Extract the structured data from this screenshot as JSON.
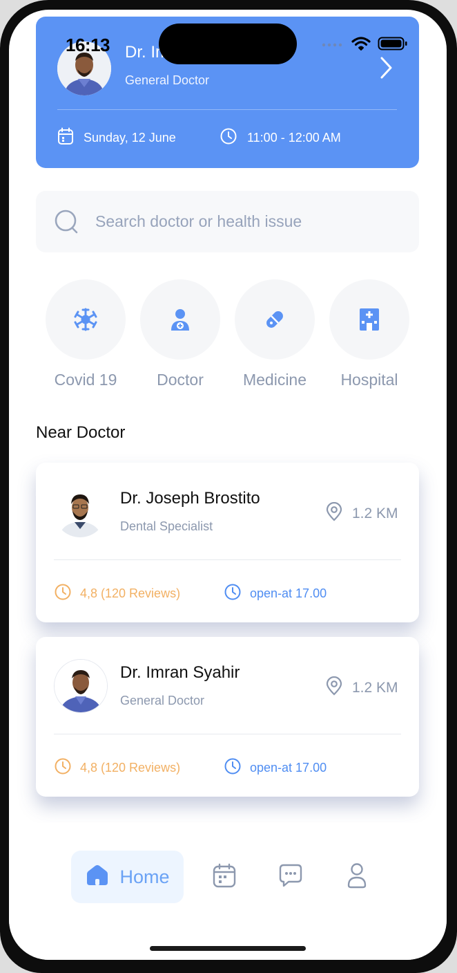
{
  "status_bar": {
    "time": "16:13"
  },
  "appointment": {
    "doctor_name": "Dr. Imran Syahir",
    "role": "General Doctor",
    "date": "Sunday, 12 June",
    "time": "11:00 - 12:00 AM"
  },
  "search": {
    "placeholder": "Search doctor or health issue"
  },
  "categories": [
    {
      "label": "Covid 19",
      "icon": "virus-icon"
    },
    {
      "label": "Doctor",
      "icon": "doctor-icon"
    },
    {
      "label": "Medicine",
      "icon": "pill-icon"
    },
    {
      "label": "Hospital",
      "icon": "hospital-icon"
    }
  ],
  "near_doctor": {
    "title": "Near Doctor",
    "doctors": [
      {
        "name": "Dr. Joseph Brostito",
        "specialty": "Dental Specialist",
        "distance": "1.2 KM",
        "rating": "4,8 (120 Reviews)",
        "open": "open-at 17.00"
      },
      {
        "name": "Dr. Imran Syahir",
        "specialty": "General Doctor",
        "distance": "1.2 KM",
        "rating": "4,8 (120 Reviews)",
        "open": "open-at 17.00"
      }
    ]
  },
  "bottom_nav": {
    "home_label": "Home",
    "items": [
      "home-icon",
      "calendar-icon",
      "chat-icon",
      "profile-icon"
    ]
  },
  "colors": {
    "primary": "#5b93f4",
    "rating": "#f2b063",
    "open": "#4f8df2",
    "muted": "#8c98ae"
  }
}
